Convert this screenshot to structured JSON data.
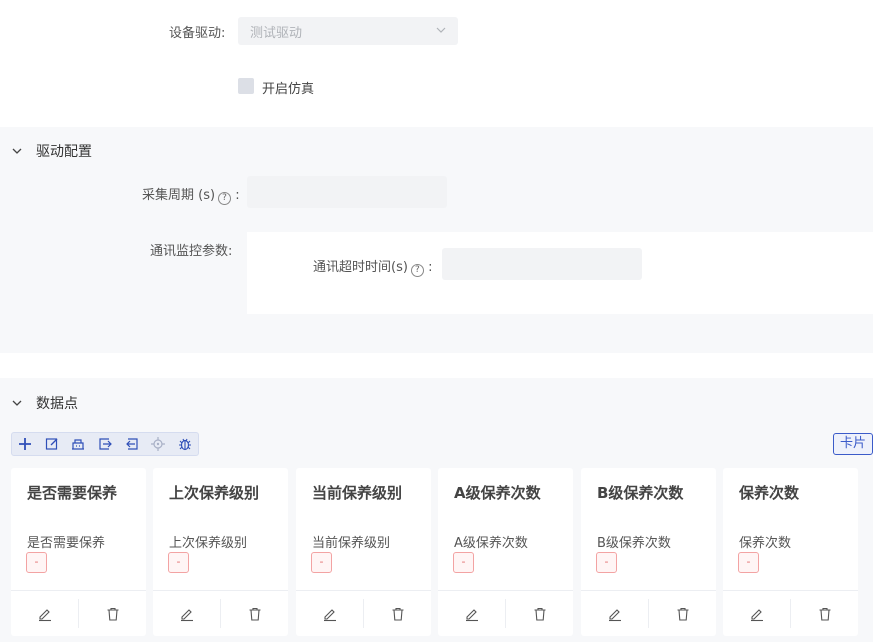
{
  "form": {
    "driver_label": "设备驱动:",
    "driver_value": "测试驱动",
    "simulate_label": "开启仿真"
  },
  "driver_config": {
    "title": "驱动配置",
    "period_label": "采集周期 (s)",
    "period_colon": ":",
    "monitor_label": "通讯监控参数:",
    "timeout_label": "通讯超时时间(s)",
    "timeout_colon": ":",
    "help_glyph": "?"
  },
  "datapoints": {
    "title": "数据点",
    "card_view_label": "卡片",
    "toolbar_icons": [
      "plus-icon",
      "edit-icon",
      "building-icon",
      "import-icon",
      "export-icon",
      "target-icon",
      "bug-icon"
    ],
    "cards": [
      {
        "title": "是否需要保养",
        "desc": "是否需要保养",
        "tag": "-"
      },
      {
        "title": "上次保养级别",
        "desc": "上次保养级别",
        "tag": "-"
      },
      {
        "title": "当前保养级别",
        "desc": "当前保养级别",
        "tag": "-"
      },
      {
        "title": "A级保养次数",
        "desc": "A级保养次数",
        "tag": "-"
      },
      {
        "title": "B级保养次数",
        "desc": "B级保养次数",
        "tag": "-"
      },
      {
        "title": "保养次数",
        "desc": "保养次数",
        "tag": "-"
      }
    ]
  }
}
